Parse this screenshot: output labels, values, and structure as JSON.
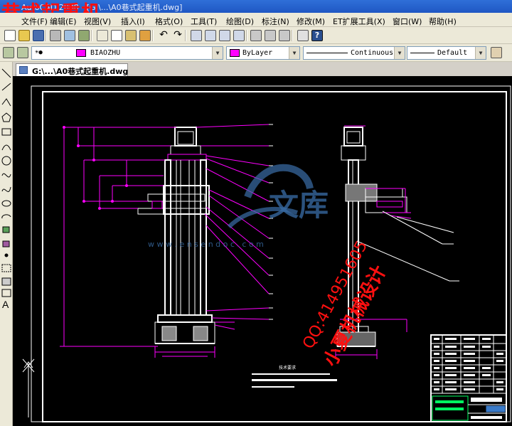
{
  "window": {
    "title": "AutoCAD 2008 - [G:\\...\\A0巷式起重机.dwg]"
  },
  "overlay_title": "巷式起重机",
  "menu": {
    "items": [
      "文件(F)",
      "编辑(E)",
      "视图(V)",
      "插入(I)",
      "格式(O)",
      "工具(T)",
      "绘图(D)",
      "标注(N)",
      "修改(M)",
      "ET扩展工具(X)",
      "窗口(W)",
      "帮助(H)"
    ]
  },
  "layer_toolbar": {
    "layer_name": "BIAOZHU",
    "color_value": "ByLayer",
    "linetype_value": "Continuous",
    "lineweight_value": "Default"
  },
  "document_tab": {
    "label": "G:\\...\\A0巷式起重机.dwg"
  },
  "drawing": {
    "tech_title": "技术要求",
    "watermark": {
      "site": "w w w . e n s e n d o c . c o m",
      "cn": "文库"
    },
    "qq_text": "QQ:414951605",
    "studio_text": "小夏机械设计"
  },
  "colors": {
    "magenta": "#ff00ff",
    "white": "#ffffff",
    "red": "#ff1010",
    "watermark": "#3a6ea8",
    "accent_blue": "#1f57c3"
  }
}
